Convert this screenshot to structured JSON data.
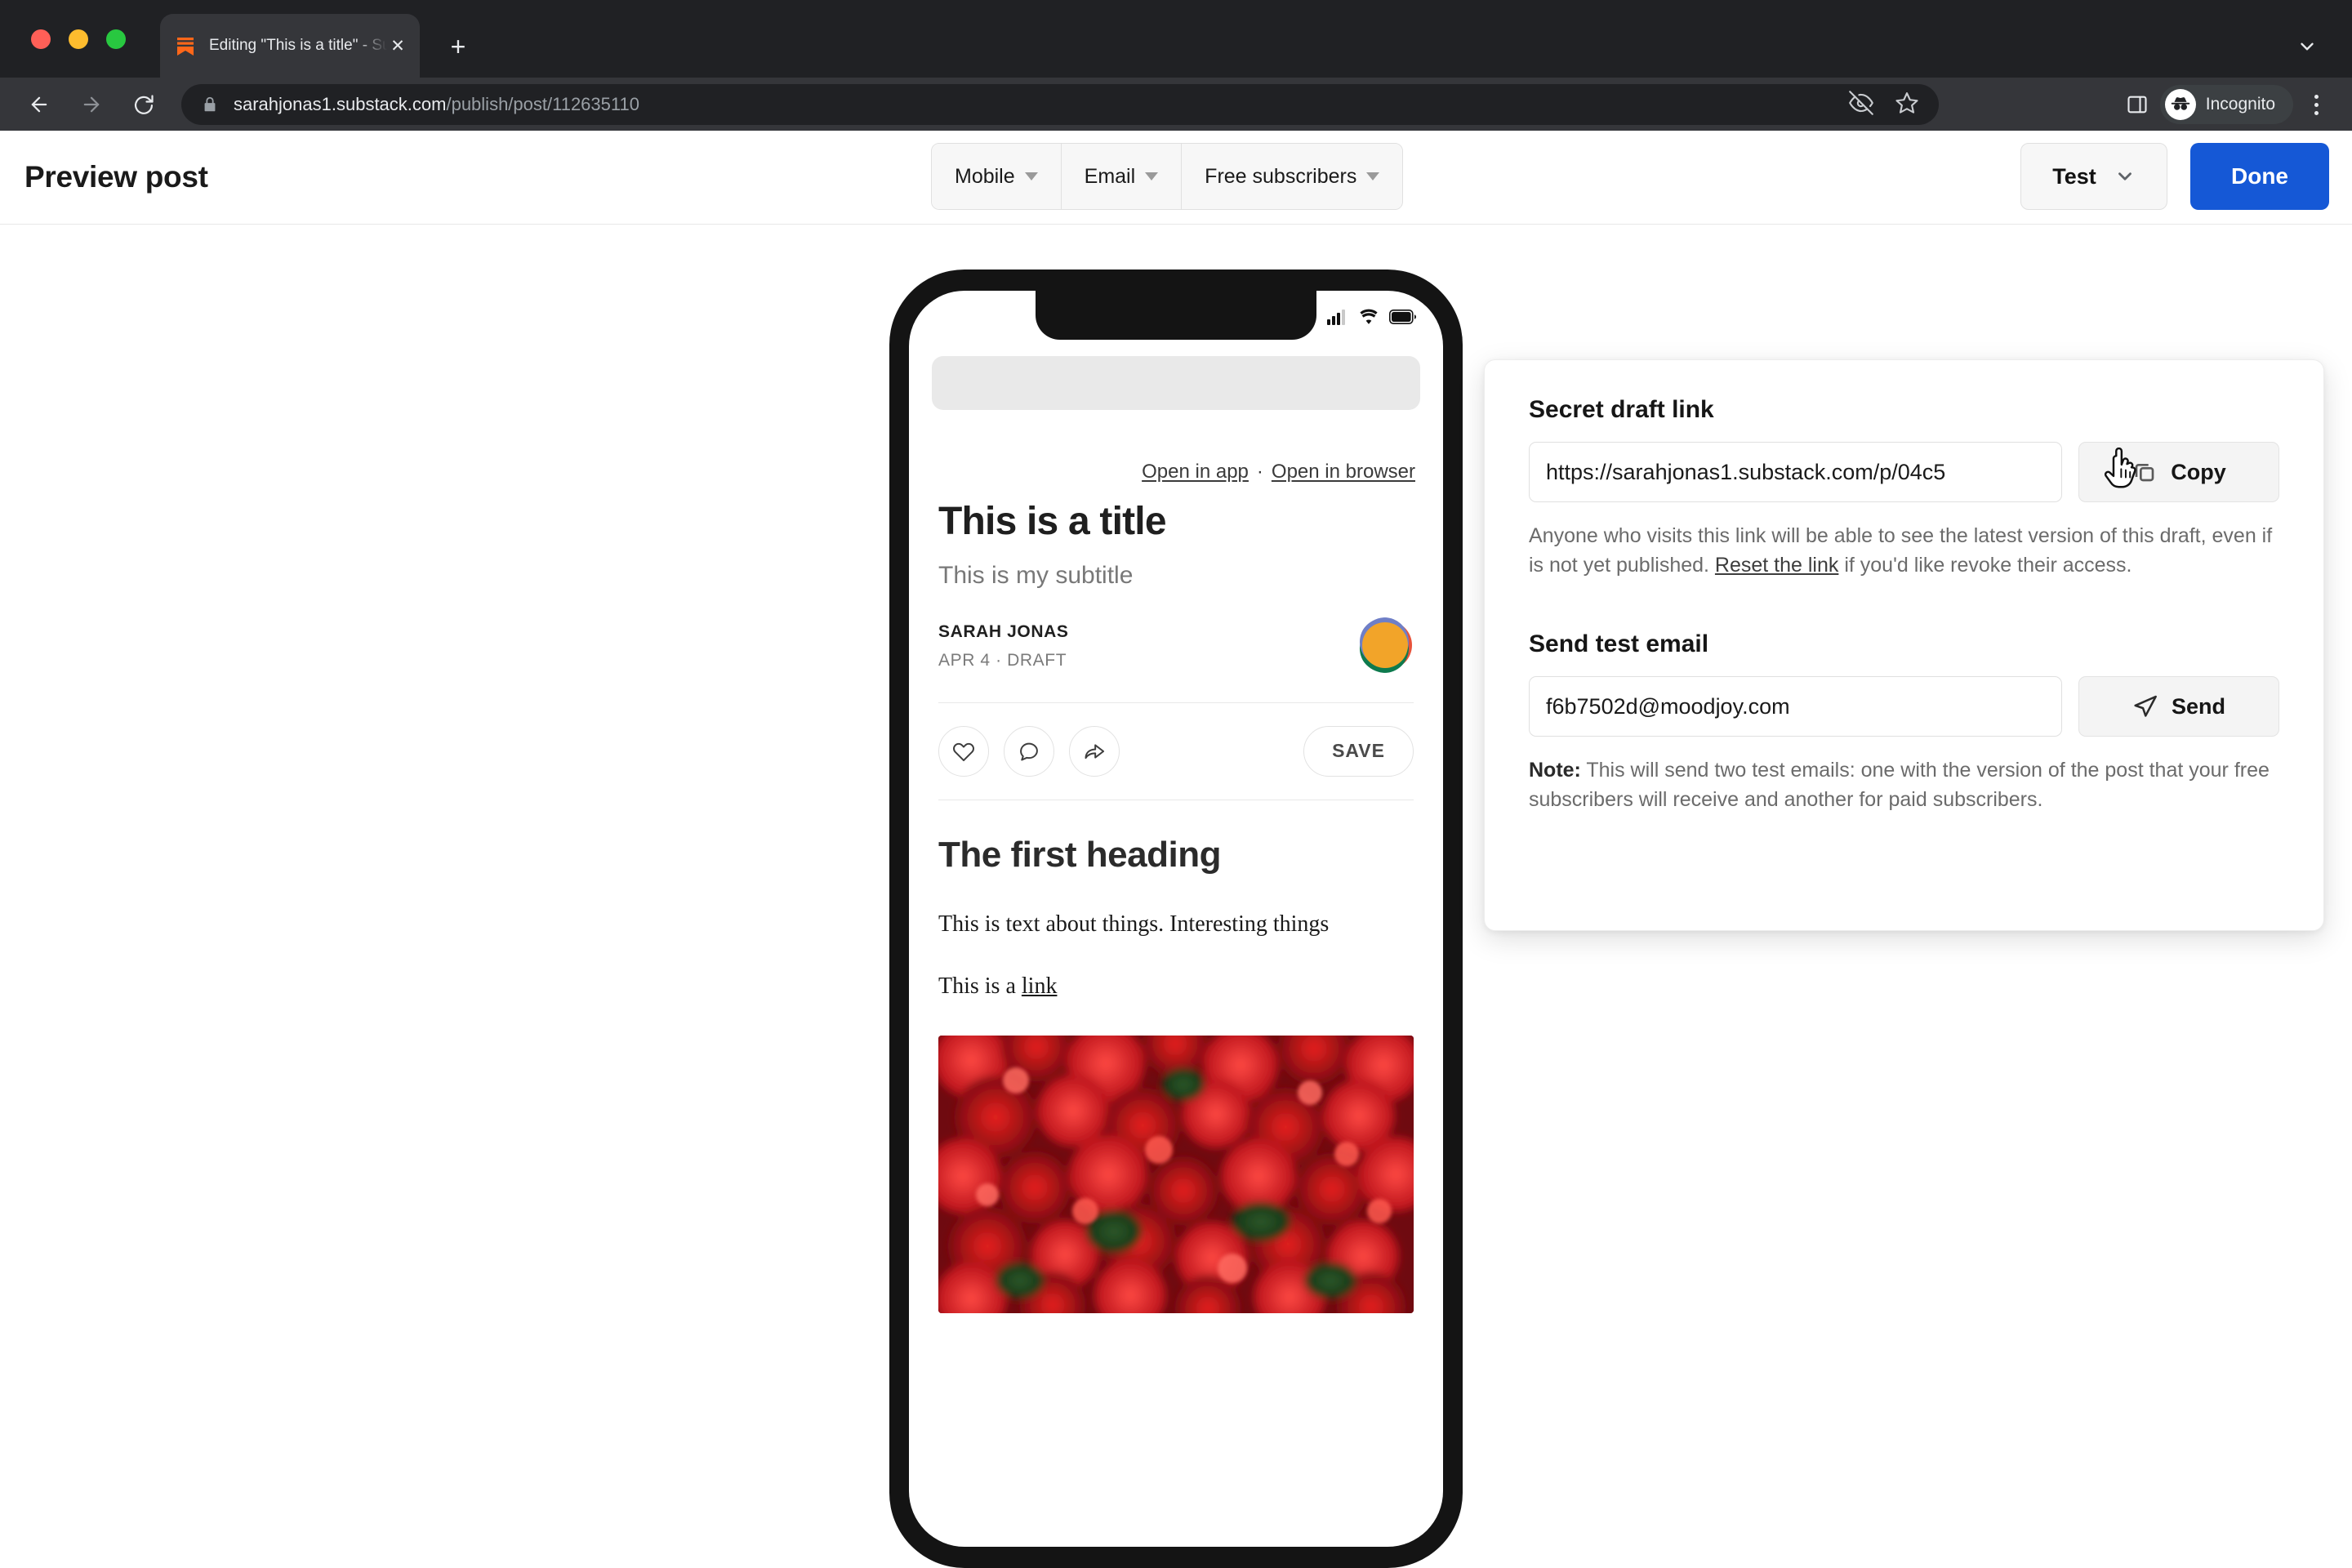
{
  "browser": {
    "tab": {
      "title": "Editing \"This is a title\" - Substa",
      "favicon_name": "substack-favicon",
      "close_label": "✕"
    },
    "new_tab_label": "+",
    "url_host": "sarahjonas1.substack.com",
    "url_path": "/publish/post/112635110",
    "profile_label": "Incognito",
    "icons": {
      "back": "back-arrow-icon",
      "forward": "forward-arrow-icon",
      "reload": "reload-icon",
      "lock": "lock-icon",
      "tracking_blocked": "eye-slash-icon",
      "bookmark": "star-icon",
      "side_panel": "side-panel-icon",
      "menu": "kebab-menu-icon",
      "tab_search": "chevron-down-icon"
    }
  },
  "app_header": {
    "title": "Preview post",
    "view_switcher": [
      {
        "label": "Mobile"
      },
      {
        "label": "Email"
      },
      {
        "label": "Free subscribers"
      }
    ],
    "test_label": "Test",
    "done_label": "Done",
    "done_color": "#1558d6"
  },
  "phone_preview": {
    "open_in_app": "Open in app",
    "separator": "·",
    "open_in_browser": "Open in browser",
    "post": {
      "title": "This is a title",
      "subtitle": "This is my subtitle",
      "author": "SARAH JONAS",
      "meta": "APR 4 · DRAFT",
      "save_label": "SAVE",
      "actions": [
        "heart-icon",
        "comment-icon",
        "share-icon"
      ],
      "heading": "The first heading",
      "paragraph_1": "This is text about things. Interesting things",
      "paragraph_2_prefix": "This is a ",
      "paragraph_2_link": "link",
      "image_alt": "red-flowers-photo"
    },
    "status_icons": [
      "cellular-signal-icon",
      "wifi-icon",
      "battery-icon"
    ]
  },
  "test_panel": {
    "secret_link": {
      "label": "Secret draft link",
      "value": "https://sarahjonas1.substack.com/p/04c5",
      "copy_label": "Copy",
      "copy_icon": "copy-icon",
      "helper_before": "Anyone who visits this link will be able to see the latest version of this draft, even if is not yet published. ",
      "helper_link": "Reset the link",
      "helper_after": " if you'd like revoke their access."
    },
    "send_test": {
      "label": "Send test email",
      "value": "f6b7502d@moodjoy.com",
      "send_label": "Send",
      "send_icon": "paper-plane-icon",
      "note_bold": "Note:",
      "note_text": " This will send two test emails: one with the version of the post that your free subscribers will receive and another for paid subscribers."
    }
  }
}
